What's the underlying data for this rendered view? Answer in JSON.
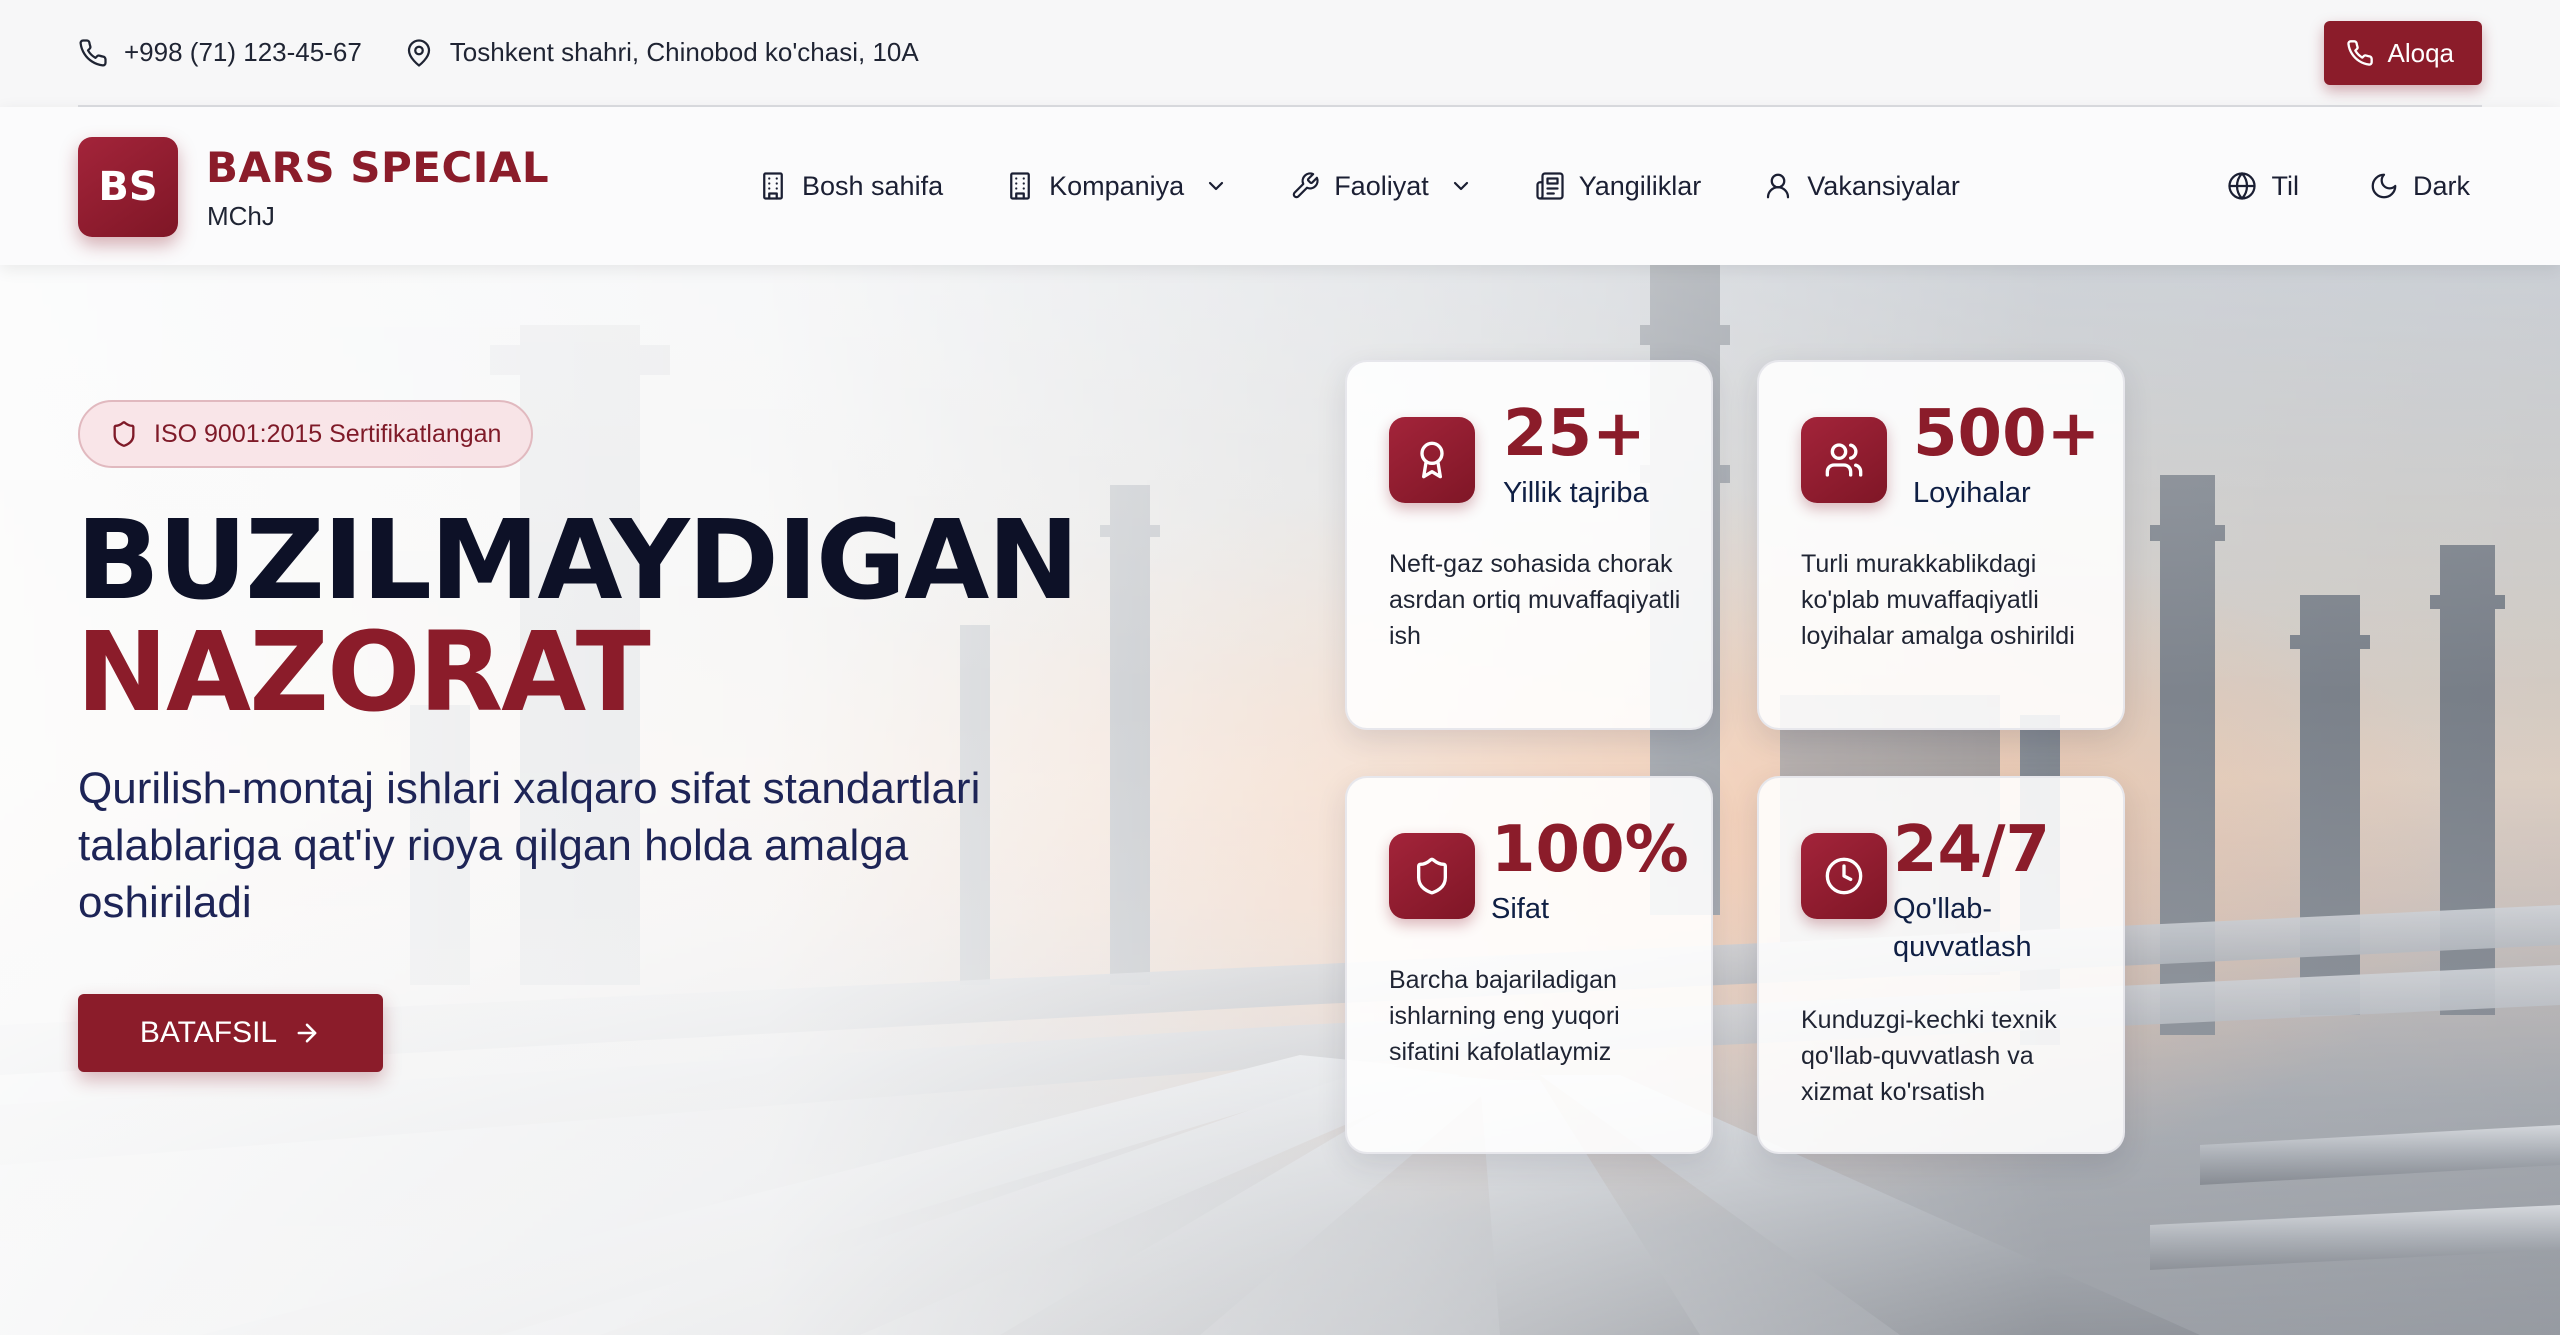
{
  "topbar": {
    "phone": "+998 (71) 123-45-67",
    "address": "Toshkent shahri, Chinobod ko'chasi, 10A",
    "contact_label": "Aloqa"
  },
  "brand": {
    "logo_text": "BS",
    "name": "BARS SPECIAL",
    "subtitle": "MChJ"
  },
  "nav": {
    "items": [
      {
        "label": "Bosh sahifa",
        "icon": "building-icon"
      },
      {
        "label": "Kompaniya",
        "icon": "building-icon",
        "dropdown": true
      },
      {
        "label": "Faoliyat",
        "icon": "wrench-icon",
        "dropdown": true
      },
      {
        "label": "Yangiliklar",
        "icon": "newspaper-icon"
      },
      {
        "label": "Vakansiyalar",
        "icon": "user-icon"
      }
    ],
    "language_label": "Til",
    "theme_label": "Dark"
  },
  "hero": {
    "badge": "ISO 9001:2015 Sertifikatlangan",
    "title_line1": "BUZILMAYDIGAN",
    "title_line2": "NAZORAT",
    "subtitle": "Qurilish-montaj ishlari xalqaro sifat standartlari talablariga qat'iy rioya qilgan holda amalga oshiriladi",
    "cta_label": "BATAFSIL"
  },
  "stats": [
    {
      "value": "25+",
      "label": "Yillik tajriba",
      "description": "Neft-gaz sohasida chorak asrdan ortiq muvaffaqiyatli ish",
      "icon": "award-icon"
    },
    {
      "value": "500+",
      "label": "Loyihalar",
      "description": "Turli murakkablikdagi ko'plab muvaffaqiyatli loyihalar amalga oshirildi",
      "icon": "users-icon"
    },
    {
      "value": "100%",
      "label": "Sifat",
      "description": "Barcha bajariladigan ishlarning eng yuqori sifatini kafolatlaymiz",
      "icon": "shield-icon"
    },
    {
      "value": "24/7",
      "label": "Qo'llab-quvvatlash",
      "description": "Kunduzgi-kechki texnik qo'llab-quvvatlash va xizmat ko'rsatish",
      "icon": "clock-icon"
    }
  ],
  "colors": {
    "brand": "#8b1c2a",
    "heading": "#0d1127",
    "subtitle": "#1d2456"
  }
}
